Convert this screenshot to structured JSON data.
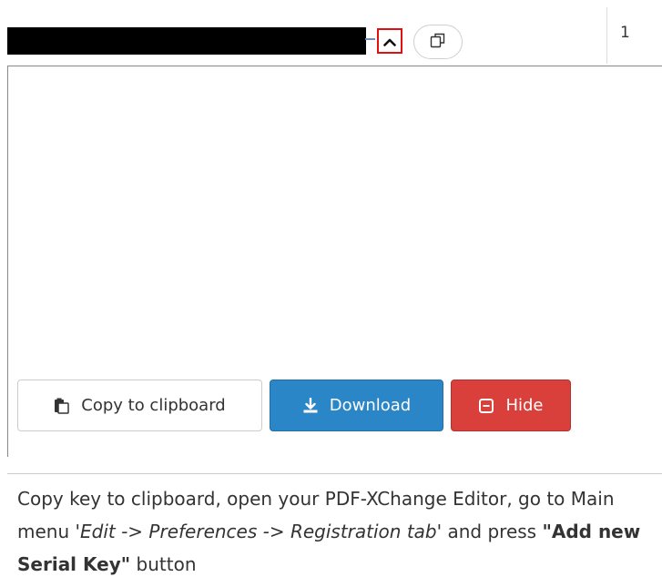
{
  "page_number": "1",
  "actions": {
    "copy_label": "Copy to clipboard",
    "download_label": "Download",
    "hide_label": "Hide"
  },
  "instructions": {
    "part1": "Copy key to clipboard, open your PDF-XChange Editor, go to Main menu ",
    "menu_path": "'Edit -> Preferences -> Registration tab'",
    "part2": " and press ",
    "button_name": "\"Add new Serial Key\"",
    "part3": " button"
  },
  "colors": {
    "download_bg": "#2b86c7",
    "hide_bg": "#d9403c",
    "highlight_border": "#e01010"
  },
  "icons": {
    "collapse": "chevron-up-icon",
    "copy_round": "copy-icon",
    "copy_button": "clipboard-icon",
    "download": "download-icon",
    "hide": "minus-square-icon"
  }
}
